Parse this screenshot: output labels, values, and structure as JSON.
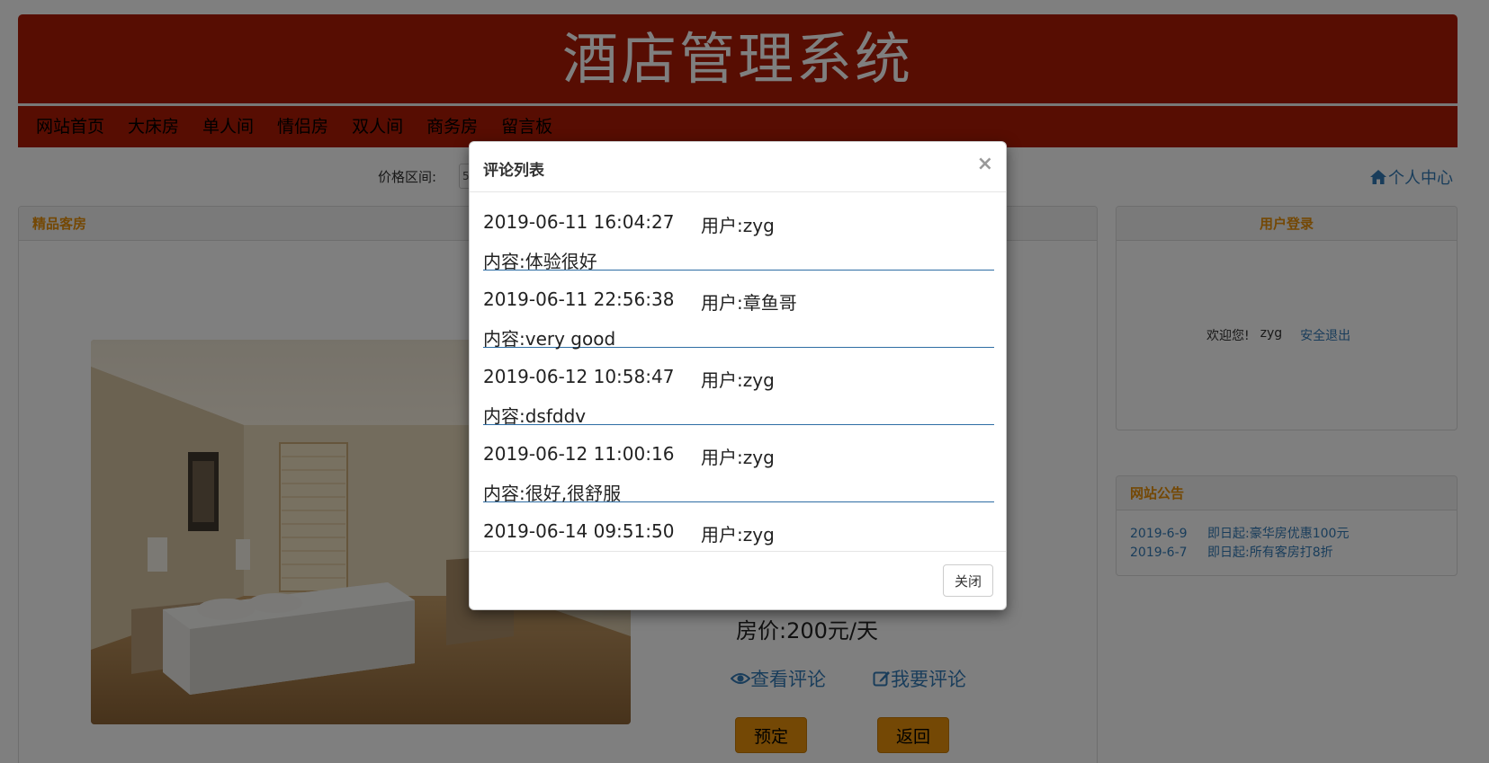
{
  "banner": {
    "title": "酒店管理系统"
  },
  "nav": {
    "items": [
      "网站首页",
      "大床房",
      "单人间",
      "情侣房",
      "双人间",
      "商务房",
      "留言板"
    ]
  },
  "filter": {
    "label": "价格区间:",
    "value_visible": "5"
  },
  "user_center": {
    "label": "个人中心",
    "icon": "home-icon"
  },
  "main_panel": {
    "heading": "精品客房",
    "price": "房价:200元/天",
    "view_reviews": "查看评论",
    "write_review": "我要评论",
    "book_button": "预定",
    "back_button": "返回"
  },
  "login_panel": {
    "heading": "用户登录",
    "welcome": "欢迎您!",
    "username": "zyg",
    "logout": "安全退出"
  },
  "notice_panel": {
    "heading": "网站公告",
    "items": [
      {
        "date": "2019-6-9",
        "text": "即日起:豪华房优惠100元"
      },
      {
        "date": "2019-6-7",
        "text": "即日起:所有客房打8折"
      }
    ]
  },
  "modal": {
    "title": "评论列表",
    "close_symbol": "×",
    "close_button": "关闭",
    "comments": [
      {
        "time": "2019-06-11 16:04:27",
        "user": "用户:zyg",
        "content": "内容:体验很好"
      },
      {
        "time": "2019-06-11 22:56:38",
        "user": "用户:章鱼哥",
        "content": "内容:very good"
      },
      {
        "time": "2019-06-12 10:58:47",
        "user": "用户:zyg",
        "content": "内容:dsfddv"
      },
      {
        "time": "2019-06-12 11:00:16",
        "user": "用户:zyg",
        "content": "内容:很好,很舒服"
      },
      {
        "time": "2019-06-14 09:51:50",
        "user": "用户:zyg",
        "content": ""
      }
    ]
  },
  "colors": {
    "brand_red": "#ae1a05",
    "accent_orange": "#e8910a",
    "link_blue": "#337ab7"
  }
}
